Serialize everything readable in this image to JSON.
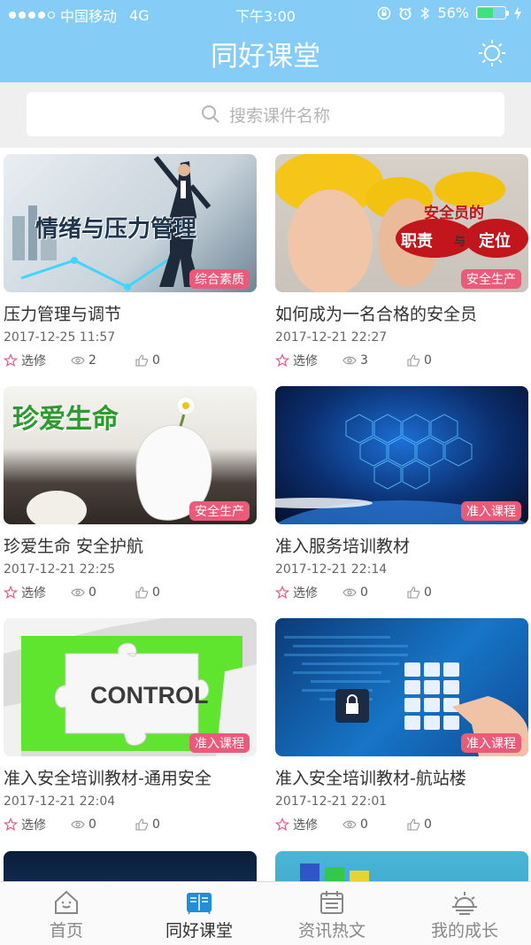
{
  "status": {
    "carrier": "中国移动",
    "network": "4G",
    "time": "下午3:00",
    "battery": "56%",
    "battery_level": 0.56
  },
  "header": {
    "title": "同好课堂",
    "settings_icon": "gear-icon"
  },
  "search": {
    "placeholder": "搜索课件名称"
  },
  "labels": {
    "elective": "选修"
  },
  "courses": [
    {
      "title": "压力管理与调节",
      "date": "2017-12-25 11:57",
      "tag": "综合素质",
      "views": "2",
      "likes": "0",
      "thumb_text": "情绪与压力管理"
    },
    {
      "title": "如何成为一名合格的安全员",
      "date": "2017-12-21 22:27",
      "tag": "安全生产",
      "views": "3",
      "likes": "0",
      "thumb_text": "安全员的",
      "thumb_text2": "职责",
      "thumb_text3": "与",
      "thumb_text4": "定位"
    },
    {
      "title": "珍爱生命 安全护航",
      "date": "2017-12-21 22:25",
      "tag": "安全生产",
      "views": "0",
      "likes": "0",
      "thumb_text": "珍爱生命"
    },
    {
      "title": "准入服务培训教材",
      "date": "2017-12-21 22:14",
      "tag": "准入课程",
      "views": "0",
      "likes": "0"
    },
    {
      "title": "准入安全培训教材-通用安全",
      "date": "2017-12-21 22:04",
      "tag": "准入课程",
      "views": "0",
      "likes": "0",
      "thumb_text": "CONTROL"
    },
    {
      "title": "准入安全培训教材-航站楼",
      "date": "2017-12-21 22:01",
      "tag": "准入课程",
      "views": "0",
      "likes": "0"
    }
  ],
  "tabs": [
    {
      "label": "首页",
      "icon": "home-icon"
    },
    {
      "label": "同好课堂",
      "icon": "book-icon"
    },
    {
      "label": "资讯热文",
      "icon": "calendar-icon"
    },
    {
      "label": "我的成长",
      "icon": "sunrise-icon"
    }
  ],
  "colors": {
    "header": "#85cdf7",
    "tag": "#ec5a7a",
    "tab_active": "#1e8fd8"
  }
}
